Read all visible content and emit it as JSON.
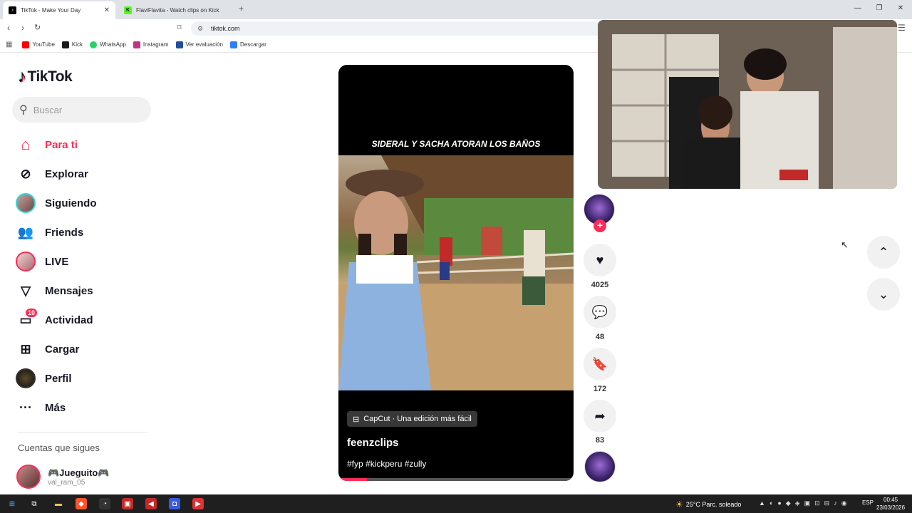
{
  "browser": {
    "tabs": [
      {
        "title": "TikTok - Make Your Day",
        "active": true
      },
      {
        "title": "FlaviFlavita - Watch clips on Kick",
        "active": false
      }
    ],
    "url": "tiktok.com",
    "bookmarks": [
      {
        "label": "YouTube",
        "color": "#ff0000"
      },
      {
        "label": "Kick",
        "color": "#1a1a1a"
      },
      {
        "label": "WhatsApp",
        "color": "#25d366"
      },
      {
        "label": "Instagram",
        "color": "#c13584"
      },
      {
        "label": "Ver evaluación",
        "color": "#1f4e9c"
      },
      {
        "label": "Descargar",
        "color": "#2d7ff9"
      }
    ]
  },
  "tiktok": {
    "logo_text": "TikTok",
    "search_placeholder": "Buscar",
    "nav": [
      {
        "label": "Para ti",
        "icon": "home-icon",
        "active": true
      },
      {
        "label": "Explorar",
        "icon": "compass-icon"
      },
      {
        "label": "Siguiendo",
        "icon": "avatar"
      },
      {
        "label": "Friends",
        "icon": "friends-icon"
      },
      {
        "label": "LIVE",
        "icon": "avatar"
      },
      {
        "label": "Mensajes",
        "icon": "send-icon"
      },
      {
        "label": "Actividad",
        "icon": "message-icon",
        "badge": "10"
      },
      {
        "label": "Cargar",
        "icon": "plus-square-icon"
      },
      {
        "label": "Perfil",
        "icon": "avatar"
      },
      {
        "label": "Más",
        "icon": "more-icon"
      }
    ],
    "following_title": "Cuentas que sigues",
    "following": [
      {
        "name": "🎮Jueguito🎮",
        "handle": "val_ram_05"
      }
    ]
  },
  "video": {
    "overlay_title": "SIDERAL Y SACHA ATORAN LOS BAÑOS",
    "capcut": "CapCut · Una edición más fácil",
    "author": "feenzclips",
    "tags": "#fyp #kickperu #zully",
    "progress": 0.12,
    "likes": "4025",
    "comments": "48",
    "saves": "172",
    "shares": "83"
  },
  "taskbar": {
    "weather": "25°C  Parc. soleado",
    "lang": "ESP",
    "time": "00:45",
    "date": "23/03/2026"
  }
}
